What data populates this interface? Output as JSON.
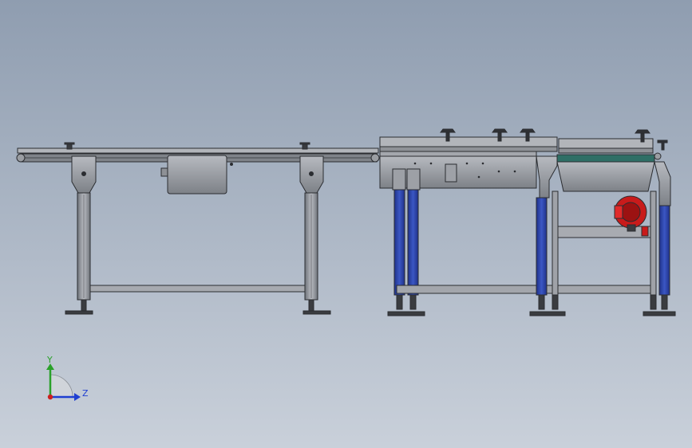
{
  "colors": {
    "steel": "#8a8d92",
    "steel_light": "#b4b7bc",
    "steel_dark": "#5e6166",
    "outline": "#2b2d31",
    "leg_blue": "#2f47a8",
    "motor_red": "#c81b1b",
    "belt_teal": "#2f6f66",
    "axis_x": "#cc1f1f",
    "axis_y": "#2aa12a",
    "axis_z": "#1f3fd1"
  },
  "triad": {
    "y_label": "Y",
    "z_label": "Z"
  },
  "icons": {
    "triad": "coordinate-triad-icon",
    "motor": "gear-motor-icon"
  }
}
